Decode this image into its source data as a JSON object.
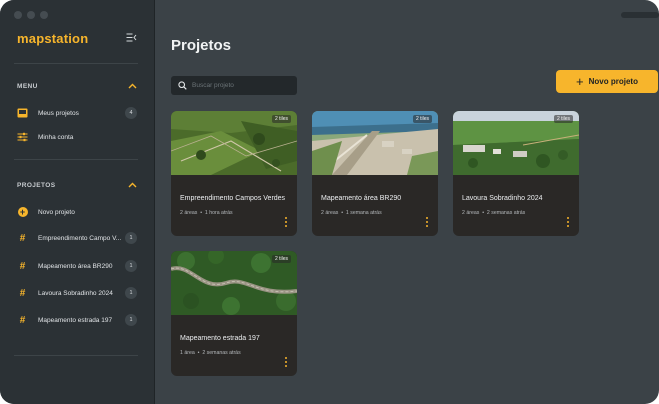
{
  "app": {
    "logo": "mapstation"
  },
  "sidebar": {
    "menu_label": "MENU",
    "menu_items": [
      {
        "label": "Meus projetos",
        "badge": "4",
        "icon": "inbox-icon"
      },
      {
        "label": "Minha conta",
        "icon": "sliders-icon"
      }
    ],
    "projects_label": "PROJETOS",
    "new_project_label": "Novo projeto",
    "projects": [
      {
        "label": "Empreendimento Campo V...",
        "badge": "1"
      },
      {
        "label": "Mapeamento área BR290",
        "badge": "1"
      },
      {
        "label": "Lavoura Sobradinho 2024",
        "badge": "1"
      },
      {
        "label": "Mapeamento estrada 197",
        "badge": "1"
      }
    ]
  },
  "main": {
    "title": "Projetos",
    "search_placeholder": "Buscar projeto",
    "new_button_label": "Novo projeto",
    "cards": [
      {
        "title": "Empreendimento Campos Verdes",
        "areas": "2 áreas",
        "time": "1 hora atrás",
        "count": "2 tiles"
      },
      {
        "title": "Mapeamento área BR290",
        "areas": "2 áreas",
        "time": "1 semana atrás",
        "count": "2 tiles"
      },
      {
        "title": "Lavoura Sobradinho 2024",
        "areas": "2 áreas",
        "time": "2 semanas atrás",
        "count": "2 tiles"
      },
      {
        "title": "Mapeamento estrada 197",
        "areas": "1 área",
        "time": "2 semanas atrás",
        "count": "2 tiles"
      }
    ]
  },
  "colors": {
    "accent": "#f7b52c",
    "sidebar": "#2b3135",
    "main": "#3b4247",
    "card": "#2a2826"
  }
}
